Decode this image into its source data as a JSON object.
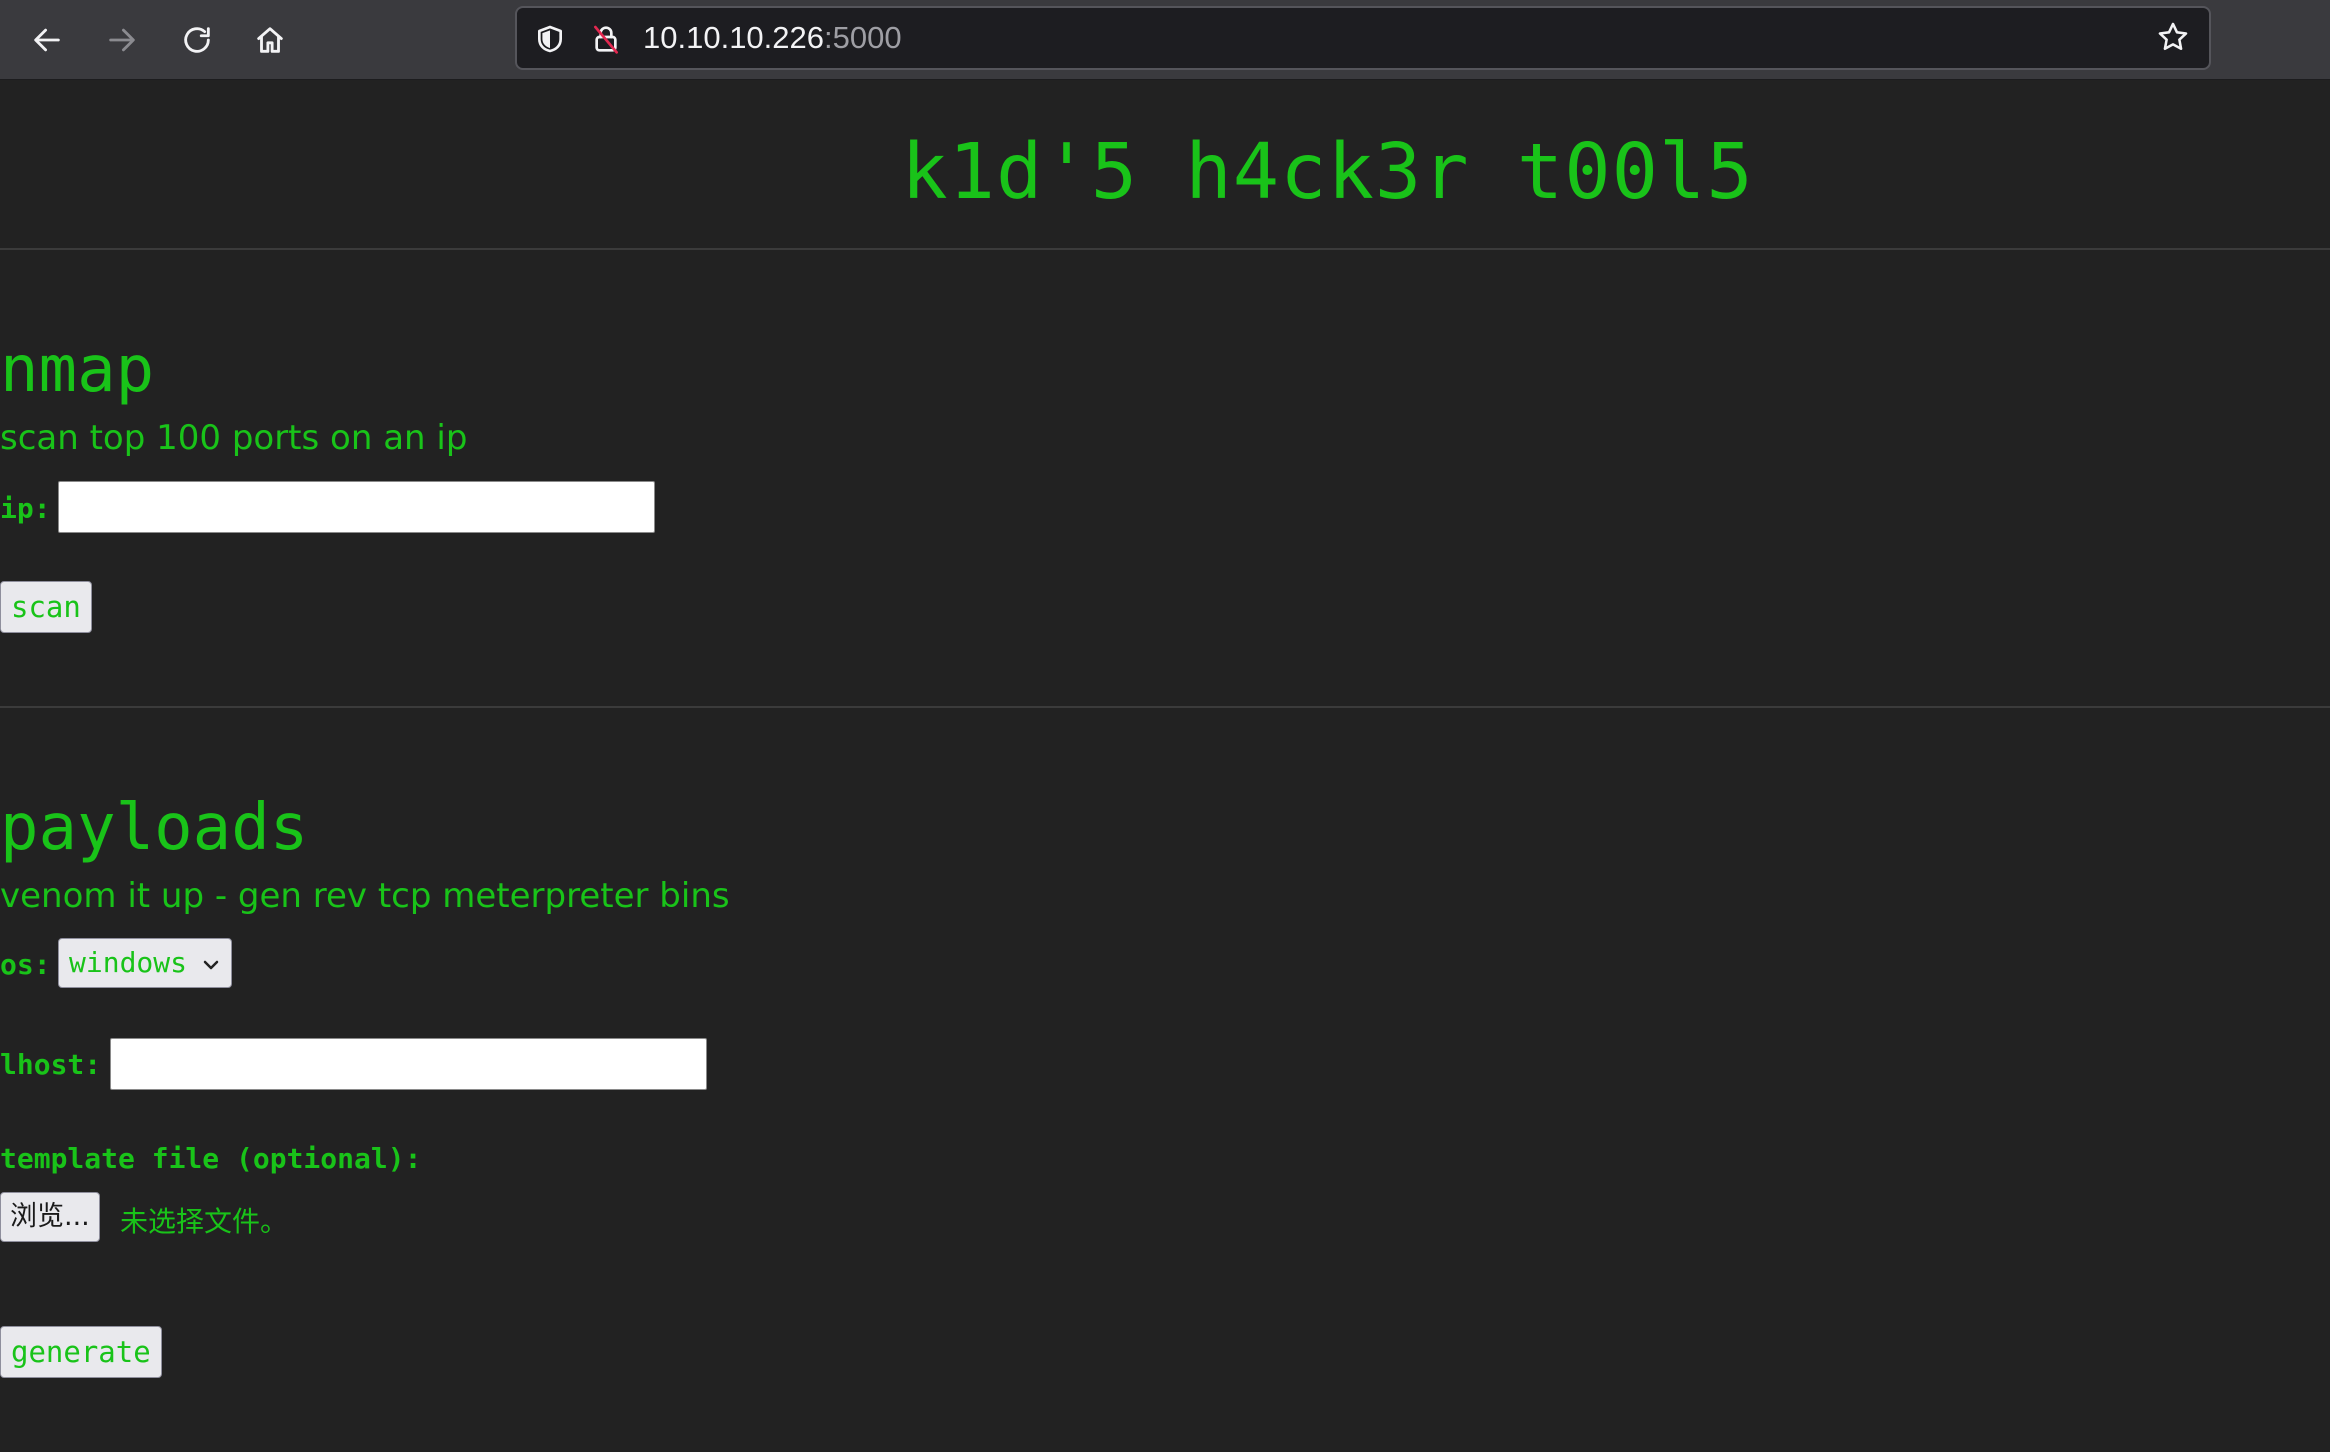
{
  "browser": {
    "url_host": "10.10.10.226",
    "url_port": ":5000",
    "icons": {
      "back": "back-arrow-icon",
      "forward": "forward-arrow-icon",
      "reload": "reload-icon",
      "home": "home-icon",
      "tracking": "shield-icon",
      "security": "insecure-lock-icon",
      "bookmark": "star-icon"
    }
  },
  "page": {
    "title": "k1d'5 h4ck3r t00l5",
    "accent_color": "#19c319",
    "background_color": "#222222"
  },
  "nmap": {
    "heading": "nmap",
    "description": "scan top 100 ports on an ip",
    "ip_label": "ip:",
    "ip_value": "",
    "submit_label": "scan"
  },
  "payloads": {
    "heading": "payloads",
    "description": "venom it up - gen rev tcp meterpreter bins",
    "os_label": "os:",
    "os_selected": "windows",
    "lhost_label": "lhost:",
    "lhost_value": "",
    "template_label": "template file (optional):",
    "browse_label": "浏览...",
    "file_status": "未选择文件。",
    "submit_label": "generate"
  }
}
